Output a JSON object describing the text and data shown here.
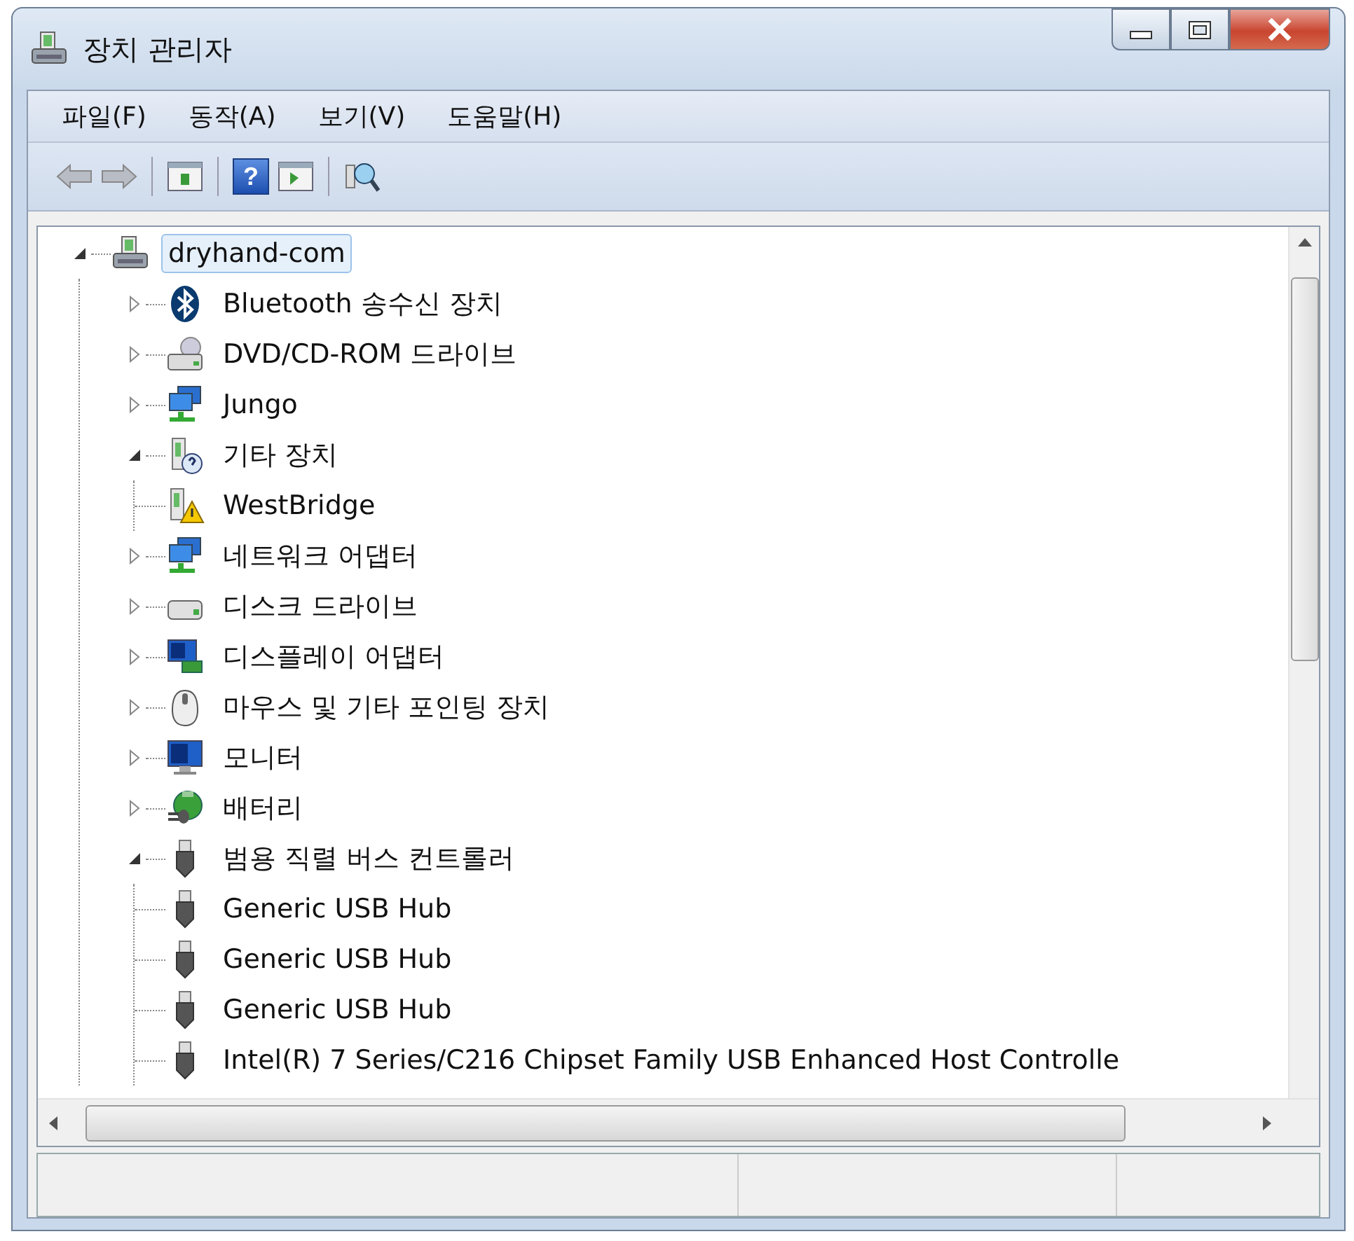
{
  "window": {
    "title": "장치 관리자"
  },
  "menu": [
    "파일(F)",
    "동작(A)",
    "보기(V)",
    "도움말(H)"
  ],
  "toolbar": [
    {
      "kind": "back"
    },
    {
      "kind": "forward"
    },
    {
      "kind": "separator"
    },
    {
      "kind": "panel"
    },
    {
      "kind": "separator"
    },
    {
      "kind": "help",
      "label": "?"
    },
    {
      "kind": "panel2"
    },
    {
      "kind": "separator"
    },
    {
      "kind": "scan"
    }
  ],
  "tree": {
    "label": "dryhand-com",
    "kind": "computer",
    "expanded": true,
    "selected": true,
    "children": [
      {
        "label": "Bluetooth 송수신 장치",
        "kind": "bluetooth",
        "expanded": false
      },
      {
        "label": "DVD/CD-ROM 드라이브",
        "kind": "dvd",
        "expanded": false
      },
      {
        "label": "Jungo",
        "kind": "network",
        "expanded": false
      },
      {
        "label": "기타 장치",
        "kind": "unknown",
        "expanded": true,
        "children": [
          {
            "label": "WestBridge",
            "kind": "warning"
          }
        ]
      },
      {
        "label": "네트워크 어댑터",
        "kind": "network",
        "expanded": false
      },
      {
        "label": "디스크 드라이브",
        "kind": "disk",
        "expanded": false
      },
      {
        "label": "디스플레이 어댑터",
        "kind": "display",
        "expanded": false
      },
      {
        "label": "마우스 및 기타 포인팅 장치",
        "kind": "mouse",
        "expanded": false
      },
      {
        "label": "모니터",
        "kind": "monitor",
        "expanded": false
      },
      {
        "label": "배터리",
        "kind": "battery",
        "expanded": false
      },
      {
        "label": "범용 직렬 버스 컨트롤러",
        "kind": "usb",
        "expanded": true,
        "children": [
          {
            "label": "Generic USB Hub",
            "kind": "usb"
          },
          {
            "label": "Generic USB Hub",
            "kind": "usb"
          },
          {
            "label": "Generic USB Hub",
            "kind": "usb"
          },
          {
            "label": "Intel(R) 7 Series/C216 Chipset Family USB Enhanced Host Controlle",
            "kind": "usb"
          }
        ]
      }
    ]
  }
}
